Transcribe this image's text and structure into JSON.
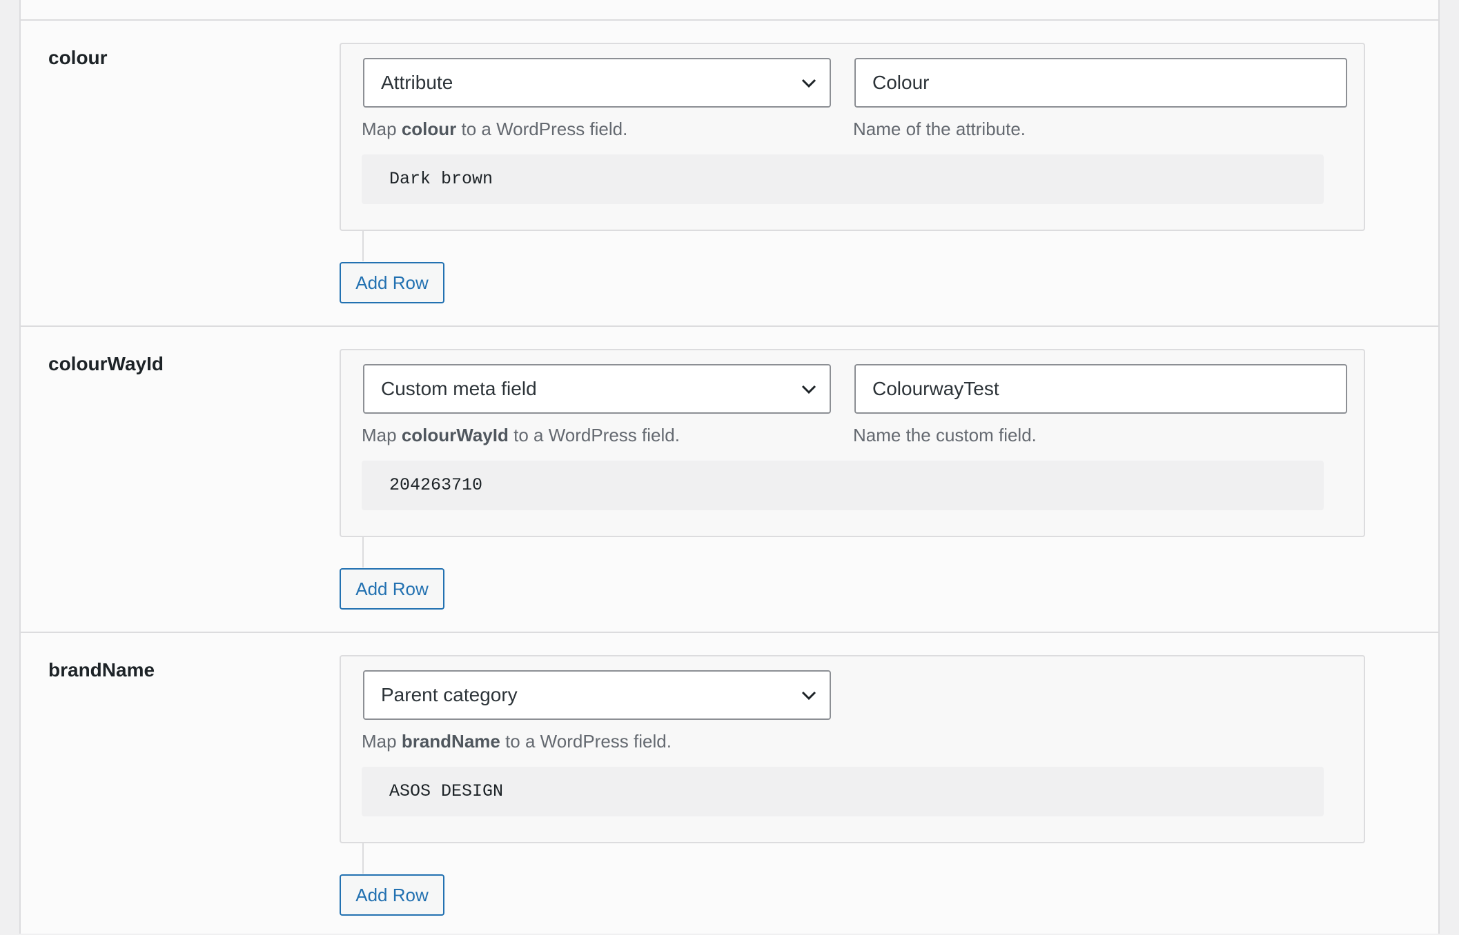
{
  "rows": [
    {
      "field_name": "colour",
      "mapping_type": "Attribute",
      "input_value": "Colour",
      "desc_prefix": "Map ",
      "desc_field": "colour",
      "desc_suffix": " to a WordPress field.",
      "input_help": "Name of the attribute.",
      "sample_value": "Dark brown",
      "add_row_label": "Add Row"
    },
    {
      "field_name": "colourWayId",
      "mapping_type": "Custom meta field",
      "input_value": "ColourwayTest",
      "desc_prefix": "Map ",
      "desc_field": "colourWayId",
      "desc_suffix": " to a WordPress field.",
      "input_help": "Name the custom field.",
      "sample_value": "204263710",
      "add_row_label": "Add Row"
    },
    {
      "field_name": "brandName",
      "mapping_type": "Parent category",
      "desc_prefix": "Map ",
      "desc_field": "brandName",
      "desc_suffix": " to a WordPress field.",
      "sample_value": "ASOS DESIGN",
      "add_row_label": "Add Row"
    }
  ],
  "icons": {
    "select_chevron": "chevron-down-icon"
  },
  "colors": {
    "accent": "#2271b1",
    "border": "#dcdcde",
    "input_border": "#8c8f94",
    "help_text": "#646970"
  }
}
